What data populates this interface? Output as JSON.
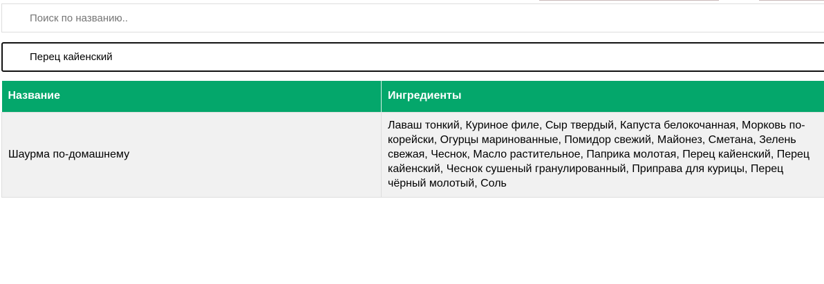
{
  "search": {
    "placeholder": "Поиск по названию..",
    "value": ""
  },
  "ingredient_filter": {
    "value": "Перец кайенский"
  },
  "table": {
    "headers": {
      "name": "Название",
      "ingredients": "Ингредиенты"
    },
    "rows": [
      {
        "name": "Шаурма по-домашнему",
        "ingredients": "Лаваш тонкий, Куриное филе, Сыр твердый, Капуста белокочанная, Морковь по-корейски, Огурцы маринованные, Помидор свежий, Майонез, Сметана, Зелень свежая, Чеснок, Масло растительное, Паприка молотая, Перец кайенский, Перец кайенский, Чеснок сушеный гранулированный, Приправа для курицы, Перец чёрный молотый, Соль"
      }
    ]
  },
  "colors": {
    "header_bg": "#04a76b",
    "row_bg": "#f1f1f1"
  }
}
